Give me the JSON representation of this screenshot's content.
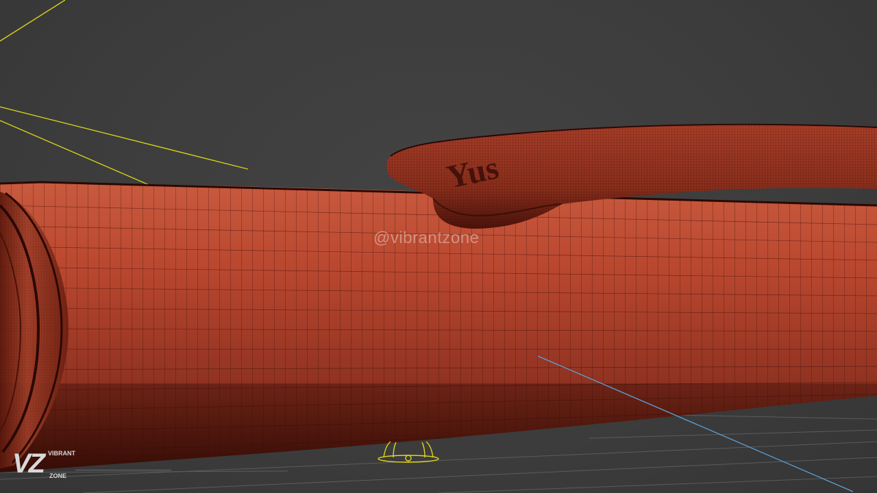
{
  "viewport": {
    "watermark_text": "@vibrantzone",
    "engraving_text": "Yus"
  },
  "logo": {
    "monogram": "VZ",
    "top_text": "VIBRANT",
    "bottom_text": "ZONE"
  },
  "colors": {
    "background": "#3b3b3b",
    "mesh_base": "#b9472f",
    "mesh_dark": "#5a160c",
    "wire": "#3a0d07",
    "light_gizmo": "#d6d11a",
    "axis_line": "#5aa0d8",
    "grid": "#6a6a6a"
  }
}
